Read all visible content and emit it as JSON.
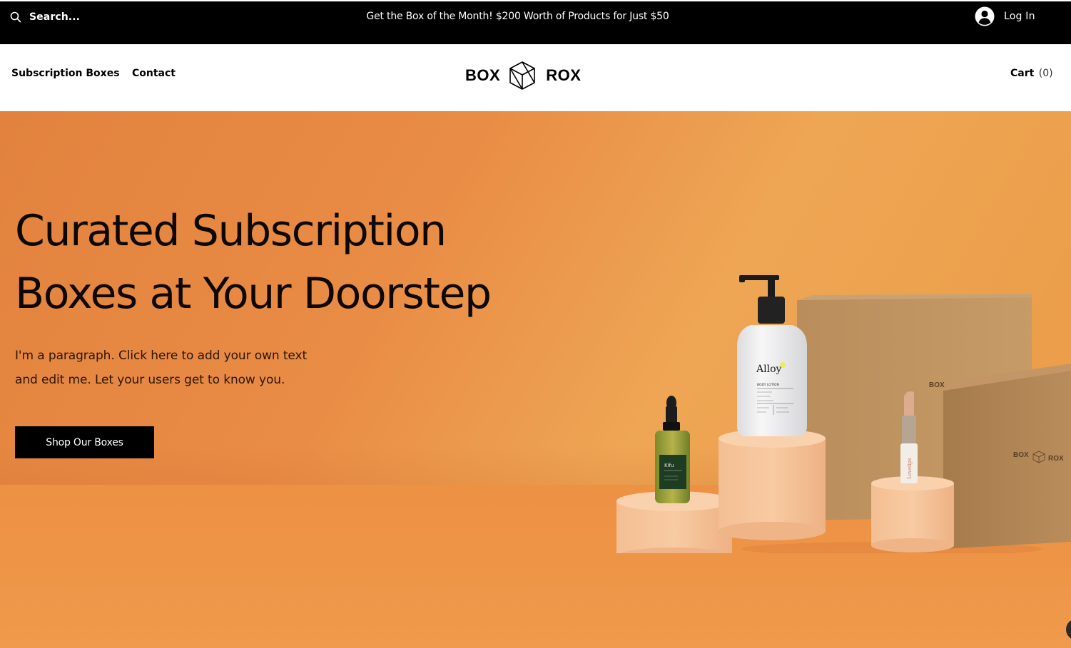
{
  "topbar": {
    "search_placeholder": "Search...",
    "promo_text": "Get the Box of the Month! $200 Worth of Products for Just $50",
    "login_label": "Log In"
  },
  "header": {
    "nav": [
      {
        "label": "Subscription Boxes"
      },
      {
        "label": "Contact"
      }
    ],
    "logo": {
      "left": "BOX",
      "right": "ROX"
    },
    "cart": {
      "label": "Cart",
      "count": "(0)"
    }
  },
  "hero": {
    "title_line1": "Curated Subscription",
    "title_line2": "Boxes at Your Doorstep",
    "paragraph_line1": "I'm a paragraph. Click here to add your own text",
    "paragraph_line2": "and edit me. Let your users get to know you.",
    "cta_label": "Shop Our Boxes",
    "products": {
      "bottle_brand": "Alloy",
      "bottle_type": "BODY LOTION",
      "serum_brand": "Kifu",
      "lipstick_brand": "Lovelips",
      "box_brand_left": "BOX",
      "box_brand_right": "ROX",
      "box_side_text": "BOX"
    }
  },
  "colors": {
    "topbar_bg": "#000000",
    "hero_orange": "#e98c45",
    "cta_bg": "#000000"
  }
}
